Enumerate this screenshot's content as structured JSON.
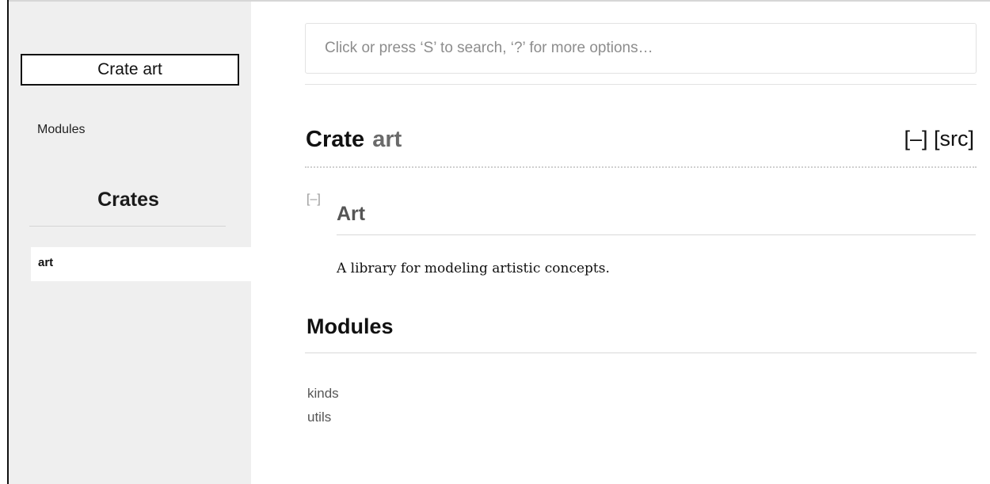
{
  "sidebar": {
    "crate_label": "Crate art",
    "modules_link": "Modules",
    "crates_heading": "Crates",
    "crates": [
      "art"
    ]
  },
  "search": {
    "placeholder": "Click or press ‘S’ to search, ‘?’ for more options…"
  },
  "main": {
    "title_keyword": "Crate",
    "title_name": "art",
    "collapse_all": "[–]",
    "src_link": "[src]",
    "doc_toggle": "[–]",
    "doc_heading": "Art",
    "doc_text": "A library for modeling artistic concepts.",
    "modules_heading": "Modules",
    "modules": [
      "kinds",
      "utils"
    ]
  }
}
